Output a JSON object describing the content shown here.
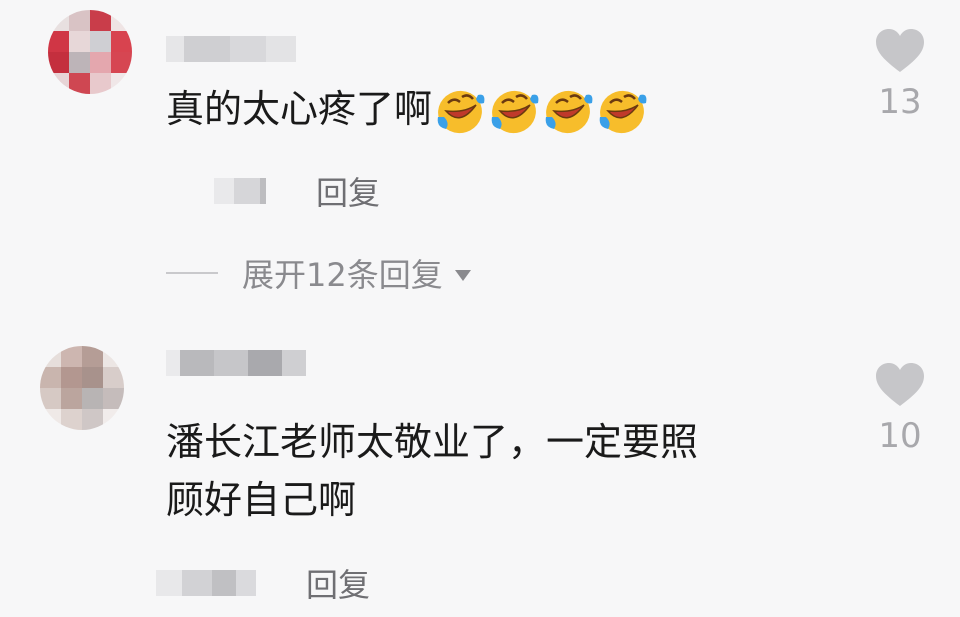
{
  "comments": [
    {
      "text": "真的太心疼了啊",
      "emoji": "laughing-crying-face",
      "emoji_count": 4,
      "likes": "13",
      "reply_label": "回复"
    },
    {
      "text_line1": "潘长江老师太敬业了，一定要照",
      "text_line2": "顾好自己啊",
      "likes": "10",
      "reply_label": "回复"
    }
  ],
  "expand_replies_label": "展开12条回复",
  "colors": {
    "background": "#f7f7f8",
    "text": "#1a1a1a",
    "muted": "#8a8a8e",
    "heart": "#c6c6c9"
  }
}
